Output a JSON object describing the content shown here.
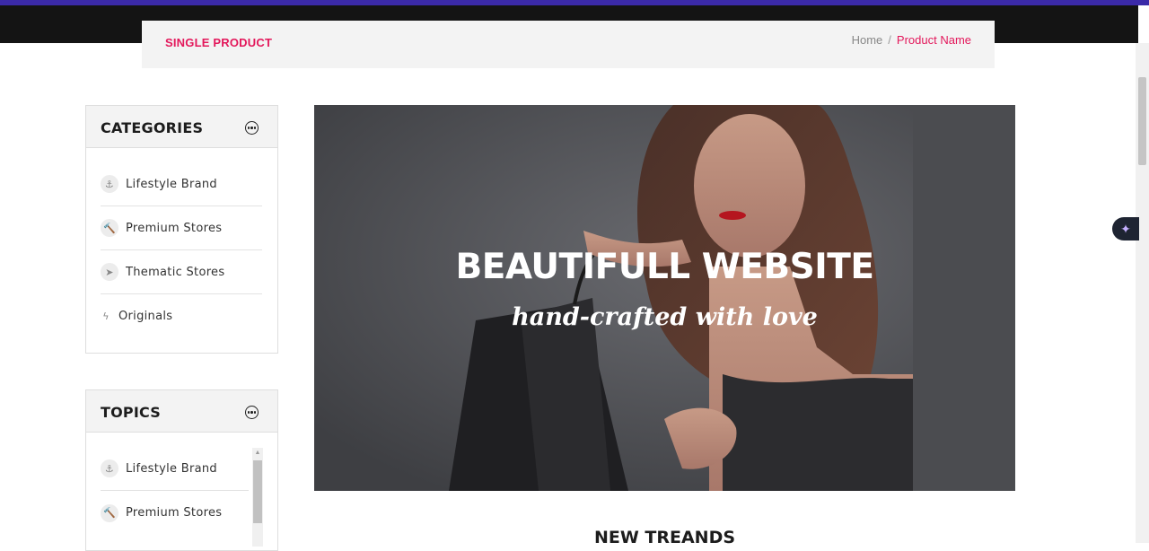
{
  "header": {
    "page_title": "SINGLE PRODUCT",
    "breadcrumb_home": "Home",
    "breadcrumb_sep": "/",
    "breadcrumb_current": "Product Name"
  },
  "categories": {
    "title": "CATEGORIES",
    "items": [
      {
        "icon": "anchor-icon",
        "glyph": "⚓",
        "label": "Lifestyle Brand"
      },
      {
        "icon": "gavel-icon",
        "glyph": "🔨",
        "label": "Premium Stores"
      },
      {
        "icon": "rocket-icon",
        "glyph": "➤",
        "label": "Thematic Stores"
      },
      {
        "icon": "bolt-icon",
        "glyph": "ϟ",
        "label": "Originals"
      }
    ]
  },
  "topics": {
    "title": "TOPICS",
    "items": [
      {
        "icon": "anchor-icon",
        "glyph": "⚓",
        "label": "Lifestyle Brand"
      },
      {
        "icon": "gavel-icon",
        "glyph": "🔨",
        "label": "Premium Stores"
      }
    ]
  },
  "banner": {
    "title": "BEAUTIFULL WEBSITE",
    "subtitle": "hand-crafted with love"
  },
  "section": {
    "heading": "NEW TREANDS"
  },
  "colors": {
    "accent": "#e3185b",
    "top_accent": "#3b2aa8",
    "top_dark": "#141414"
  },
  "fab": {
    "icon": "sparkle-icon",
    "glyph": "✦"
  }
}
